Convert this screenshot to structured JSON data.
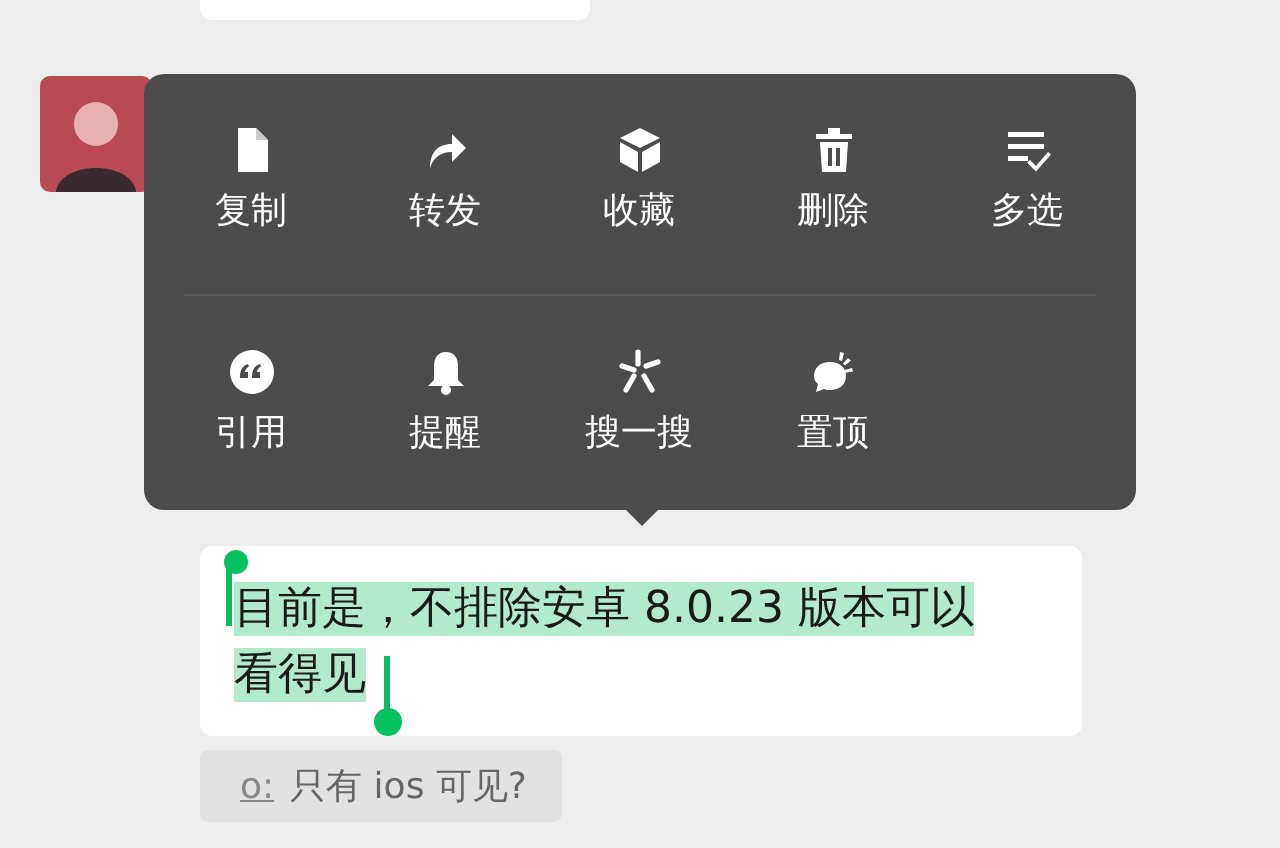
{
  "menu": {
    "rows": [
      [
        {
          "kind": "copy",
          "label": "复制"
        },
        {
          "kind": "forward",
          "label": "转发"
        },
        {
          "kind": "favorite",
          "label": "收藏"
        },
        {
          "kind": "delete",
          "label": "删除"
        },
        {
          "kind": "multiselect",
          "label": "多选"
        }
      ],
      [
        {
          "kind": "quote",
          "label": "引用"
        },
        {
          "kind": "remind",
          "label": "提醒"
        },
        {
          "kind": "search",
          "label": "搜一搜"
        },
        {
          "kind": "pin",
          "label": "置顶"
        }
      ]
    ]
  },
  "message": {
    "lines": [
      "目前是，不排除安卓 8.0.23 版本可以",
      "看得见"
    ],
    "selected": true
  },
  "quote": {
    "name": "o:",
    "text": "只有 ios 可见?"
  }
}
